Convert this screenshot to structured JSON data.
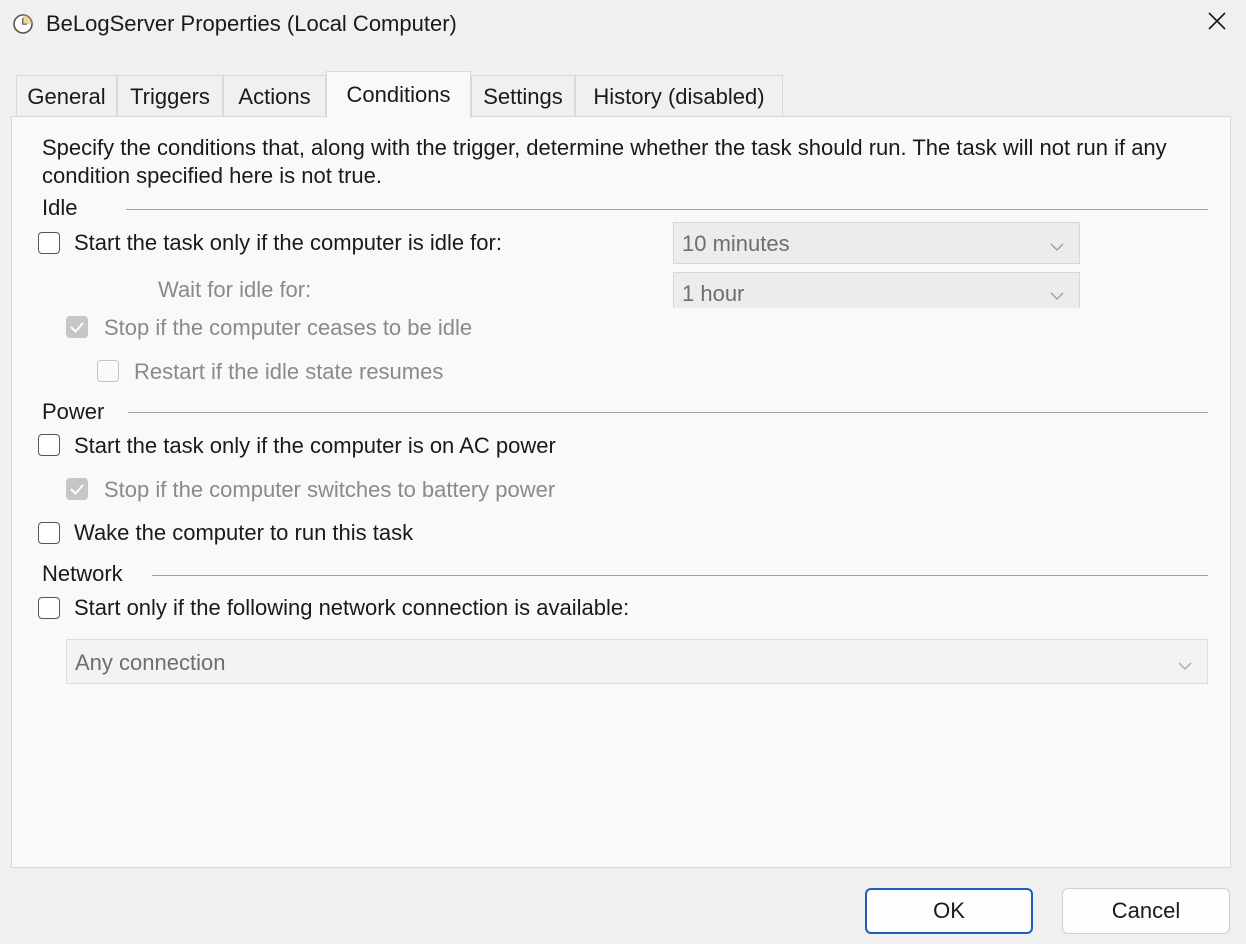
{
  "window": {
    "title": "BeLogServer Properties (Local Computer)"
  },
  "tabs": [
    {
      "label": "General"
    },
    {
      "label": "Triggers"
    },
    {
      "label": "Actions"
    },
    {
      "label": "Conditions"
    },
    {
      "label": "Settings"
    },
    {
      "label": "History (disabled)"
    }
  ],
  "active_tab": "Conditions",
  "description": "Specify the conditions that, along with the trigger, determine whether the task should run.  The task will not run  if any condition specified here is not true.",
  "idle": {
    "group_label": "Idle",
    "start_if_idle": {
      "label": "Start the task only if the computer is idle for:",
      "checked": false
    },
    "idle_for_value": "10 minutes",
    "wait_label": "Wait for idle for:",
    "wait_value": "1 hour",
    "stop_if_ceases": {
      "label": "Stop if the computer ceases to be idle",
      "checked": true
    },
    "restart_if_resumes": {
      "label": "Restart if the idle state resumes",
      "checked": false
    }
  },
  "power": {
    "group_label": "Power",
    "start_on_ac": {
      "label": "Start the task only if the computer is on AC power",
      "checked": false
    },
    "stop_on_battery": {
      "label": "Stop if the computer switches to battery power",
      "checked": true
    },
    "wake_to_run": {
      "label": "Wake the computer to run this task",
      "checked": false
    }
  },
  "network": {
    "group_label": "Network",
    "start_if_network": {
      "label": "Start only if the following network connection is available:",
      "checked": false
    },
    "connection_value": "Any connection"
  },
  "buttons": {
    "ok": "OK",
    "cancel": "Cancel"
  },
  "colors": {
    "primary_button_border": "#1f5fb6",
    "disabled_text": "#8a8a8a",
    "panel_background": "#f9f9f9",
    "window_background": "#f0f0f0"
  }
}
